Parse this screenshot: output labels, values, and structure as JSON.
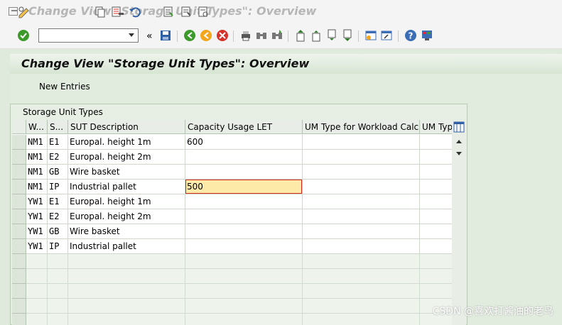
{
  "window": {
    "title": "Change View \"Storage Unit Types\": Overview"
  },
  "toolbar": {
    "command_field_value": "",
    "icons": [
      "enter-icon",
      "back-double-arrow-icon",
      "save-icon",
      "back-icon",
      "exit-icon",
      "cancel-icon",
      "print-icon",
      "find-icon",
      "find-next-icon",
      "first-page-icon",
      "previous-page-icon",
      "next-page-icon",
      "last-page-icon",
      "create-session-icon",
      "shortcut-icon",
      "help-icon",
      "customize-layout-icon"
    ]
  },
  "page": {
    "title": "Change View \"Storage Unit Types\": Overview",
    "new_entries_label": "New Entries"
  },
  "table": {
    "caption": "Storage Unit Types",
    "columns": [
      "W...",
      "S...",
      "SUT Description",
      "Capacity Usage LET",
      "UM Type for Workload Calc...",
      "UM Type"
    ],
    "rows": [
      {
        "w": "NM1",
        "s": "E1",
        "desc": "Europal. height 1m",
        "cap": "600",
        "um": "",
        "umt": ""
      },
      {
        "w": "NM1",
        "s": "E2",
        "desc": "Europal. height 2m",
        "cap": "",
        "um": "",
        "umt": ""
      },
      {
        "w": "NM1",
        "s": "GB",
        "desc": "Wire basket",
        "cap": "",
        "um": "",
        "umt": ""
      },
      {
        "w": "NM1",
        "s": "IP",
        "desc": "Industrial pallet",
        "cap": "500",
        "um": "",
        "umt": ""
      },
      {
        "w": "YW1",
        "s": "E1",
        "desc": "Europal. height 1m",
        "cap": "",
        "um": "",
        "umt": ""
      },
      {
        "w": "YW1",
        "s": "E2",
        "desc": "Europal. height 2m",
        "cap": "",
        "um": "",
        "umt": ""
      },
      {
        "w": "YW1",
        "s": "GB",
        "desc": "Wire basket",
        "cap": "",
        "um": "",
        "umt": ""
      },
      {
        "w": "YW1",
        "s": "IP",
        "desc": "Industrial pallet",
        "cap": "",
        "um": "",
        "umt": ""
      }
    ],
    "focused_cell": {
      "row": 3,
      "column": "cap"
    }
  },
  "watermark": "CSDN @喜欢打酱油的老鸟",
  "colors": {
    "focused_cell_bg": "#fde9a8",
    "focused_corner": "#d22a1f",
    "header_green": "#d7e5d3"
  }
}
